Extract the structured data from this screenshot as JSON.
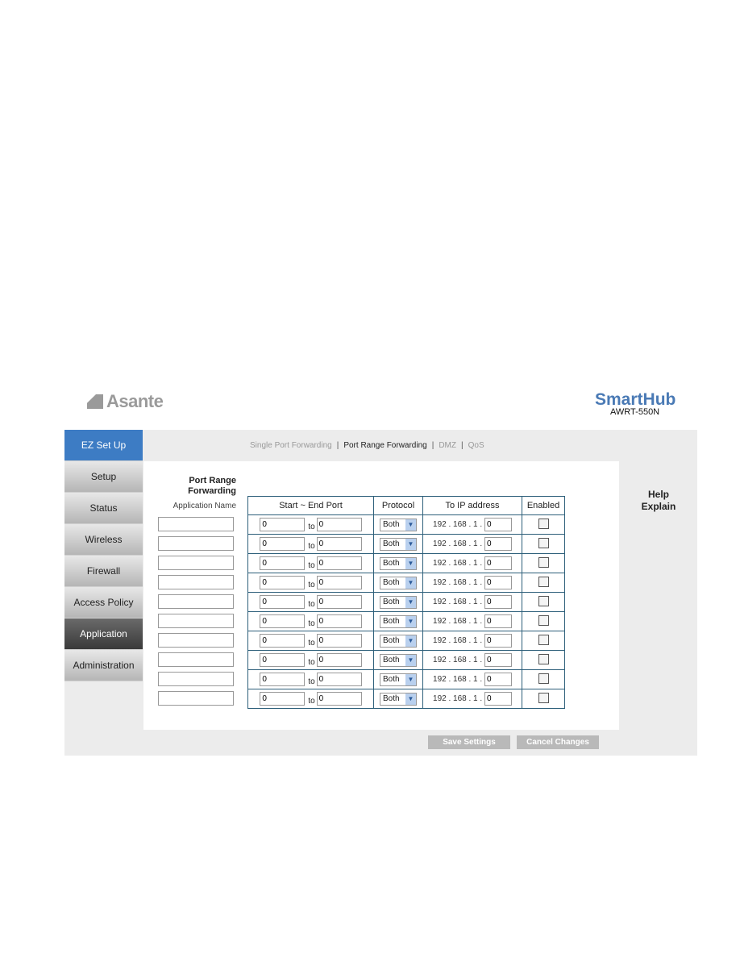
{
  "header": {
    "logo": "Asante",
    "brand": "SmartHub",
    "model": "AWRT-550N"
  },
  "subnav": [
    {
      "label": "Single Port Forwarding",
      "active": false
    },
    {
      "label": "Port Range Forwarding",
      "active": true
    },
    {
      "label": "DMZ",
      "active": false
    },
    {
      "label": "QoS",
      "active": false
    }
  ],
  "sidebar": {
    "items": [
      {
        "label": "EZ Set Up"
      },
      {
        "label": "Setup"
      },
      {
        "label": "Status"
      },
      {
        "label": "Wireless"
      },
      {
        "label": "Firewall"
      },
      {
        "label": "Access Policy"
      },
      {
        "label": "Application"
      },
      {
        "label": "Administration"
      }
    ]
  },
  "main": {
    "title_line1": "Port Range",
    "title_line2": "Forwarding",
    "app_name_label": "Application Name",
    "columns": [
      "Start ~ End Port",
      "Protocol",
      "To IP address",
      "Enabled"
    ],
    "to_label": "to",
    "ip_prefix": "192 . 168 . 1 .",
    "rows": [
      {
        "app": "",
        "start": "0",
        "end": "0",
        "protocol": "Both",
        "ip_last": "0",
        "enabled": false
      },
      {
        "app": "",
        "start": "0",
        "end": "0",
        "protocol": "Both",
        "ip_last": "0",
        "enabled": false
      },
      {
        "app": "",
        "start": "0",
        "end": "0",
        "protocol": "Both",
        "ip_last": "0",
        "enabled": false
      },
      {
        "app": "",
        "start": "0",
        "end": "0",
        "protocol": "Both",
        "ip_last": "0",
        "enabled": false
      },
      {
        "app": "",
        "start": "0",
        "end": "0",
        "protocol": "Both",
        "ip_last": "0",
        "enabled": false
      },
      {
        "app": "",
        "start": "0",
        "end": "0",
        "protocol": "Both",
        "ip_last": "0",
        "enabled": false
      },
      {
        "app": "",
        "start": "0",
        "end": "0",
        "protocol": "Both",
        "ip_last": "0",
        "enabled": false
      },
      {
        "app": "",
        "start": "0",
        "end": "0",
        "protocol": "Both",
        "ip_last": "0",
        "enabled": false
      },
      {
        "app": "",
        "start": "0",
        "end": "0",
        "protocol": "Both",
        "ip_last": "0",
        "enabled": false
      },
      {
        "app": "",
        "start": "0",
        "end": "0",
        "protocol": "Both",
        "ip_last": "0",
        "enabled": false
      }
    ]
  },
  "help": {
    "line1": "Help",
    "line2": "Explain"
  },
  "buttons": {
    "save": "Save Settings",
    "cancel": "Cancel Changes"
  }
}
